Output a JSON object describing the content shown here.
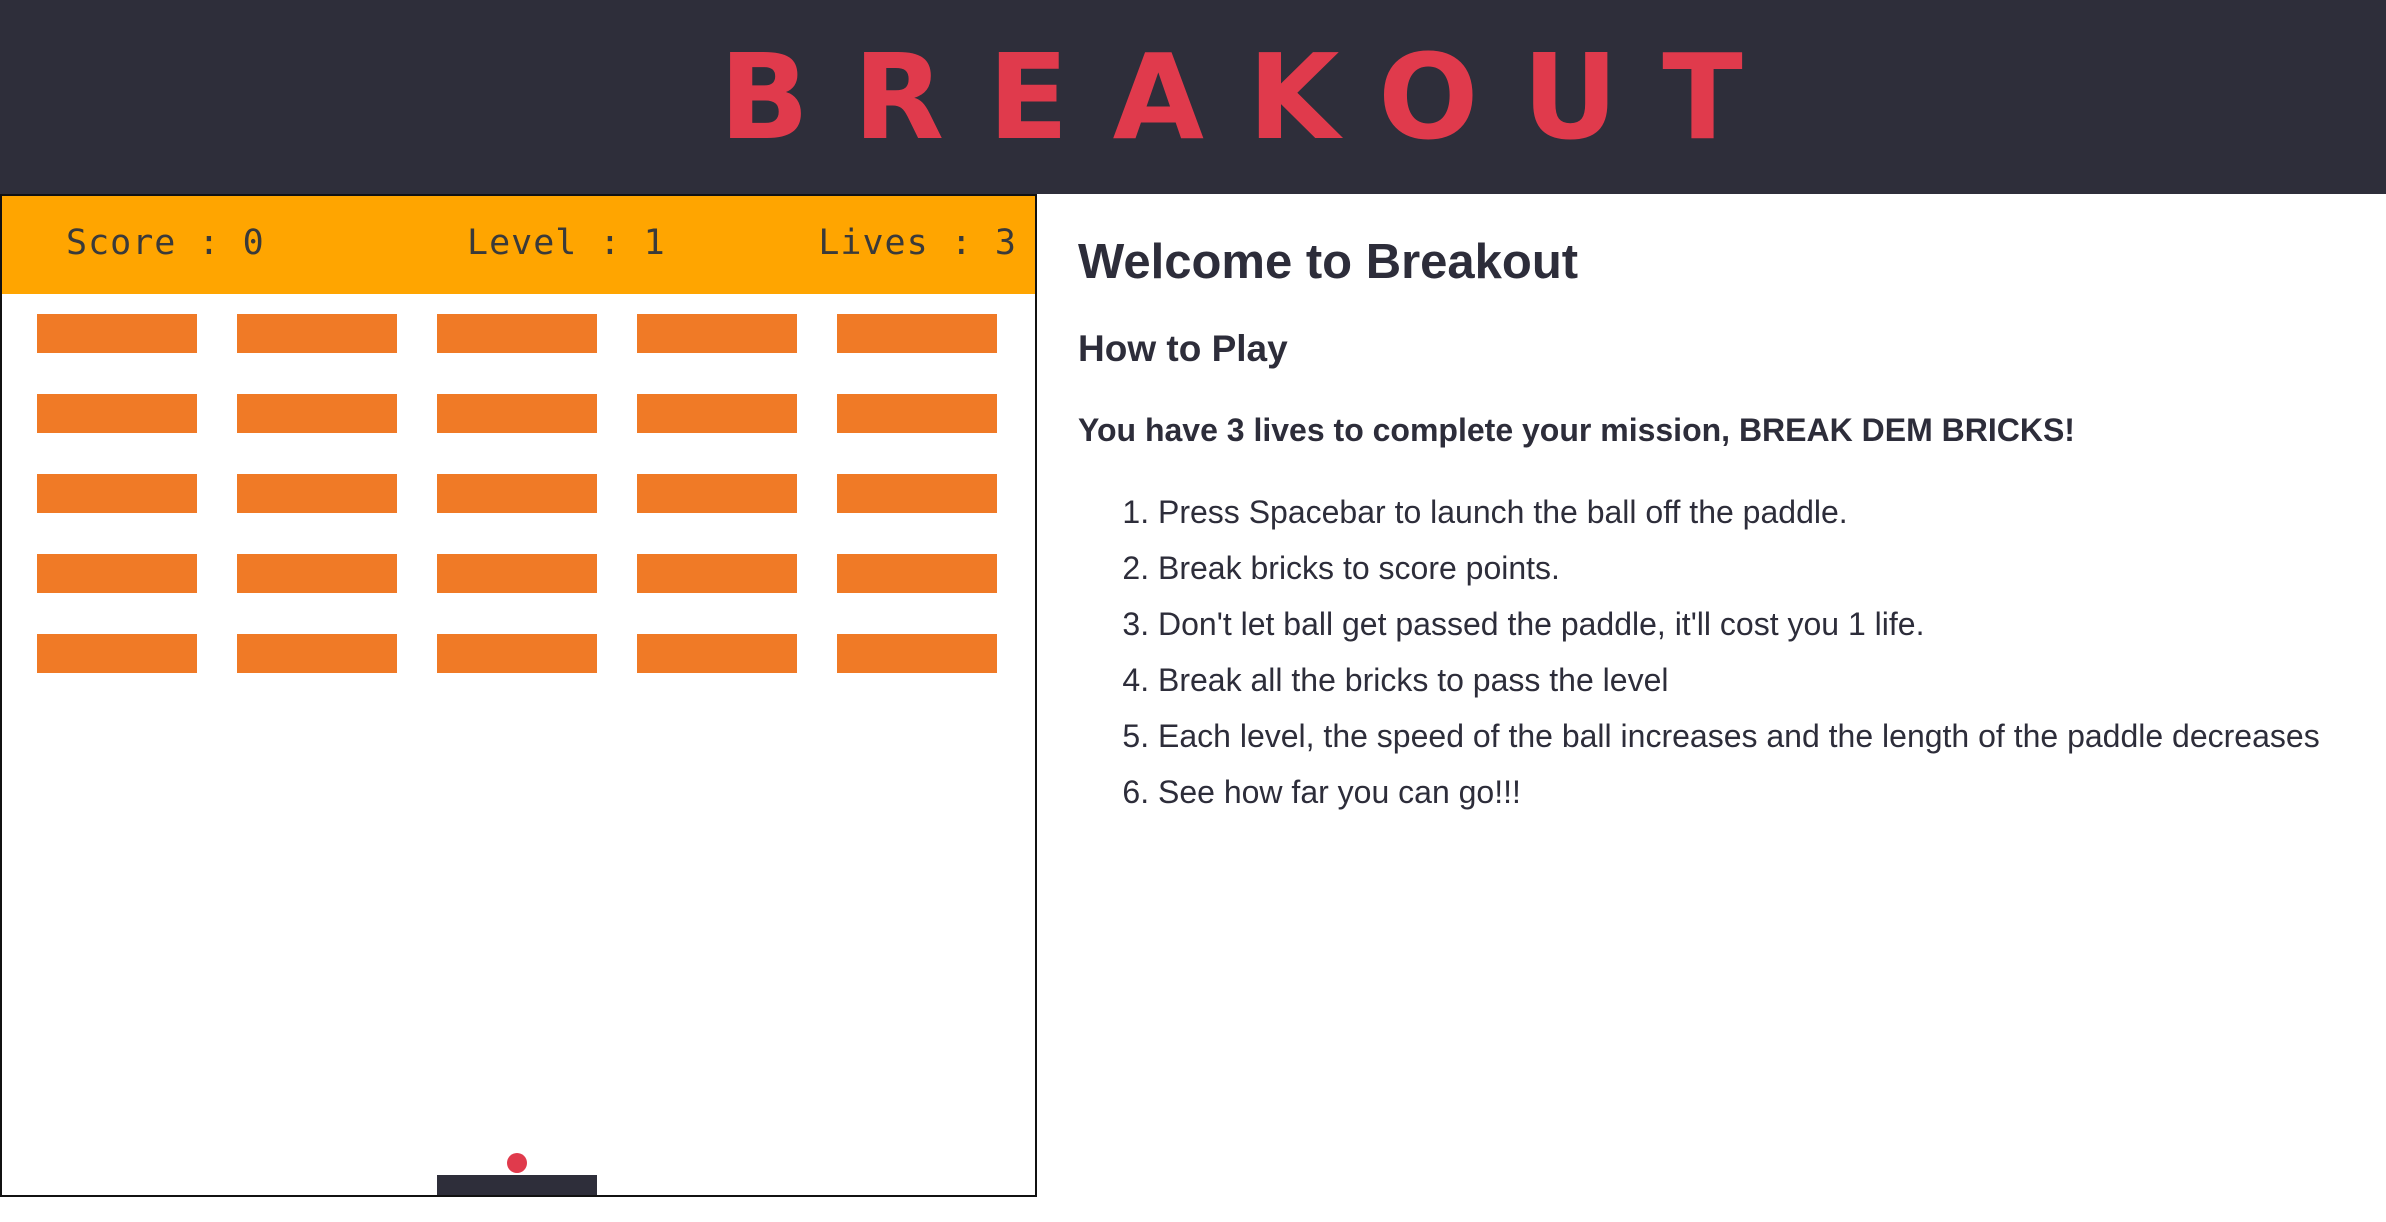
{
  "header": {
    "title": "BREAKOUT"
  },
  "colors": {
    "header_bg": "#2e2e3a",
    "title": "#e03a4c",
    "hud_bg": "#ffa500",
    "hud_text": "#3a3a3a",
    "brick": "#f07a26",
    "ball": "#e03a4c",
    "paddle": "#2e2e3a",
    "text": "#2d2d3a"
  },
  "hud": {
    "score_label": "Score : 0",
    "level_label": "Level : 1",
    "lives_label": "Lives : 3"
  },
  "game": {
    "brick_rows": 5,
    "brick_cols": 5,
    "ball_launched": false
  },
  "info": {
    "welcome": "Welcome to Breakout",
    "how_to_play": "How to Play",
    "mission": "You have 3 lives to complete your mission, BREAK DEM BRICKS!",
    "steps": [
      "Press Spacebar to launch the ball off the paddle.",
      "Break bricks to score points.",
      "Don't let ball get passed the paddle, it'll cost you 1 life.",
      "Break all the bricks to pass the level",
      "Each level, the speed of the ball increases and the length of the paddle decreases",
      "See how far you can go!!!"
    ]
  }
}
